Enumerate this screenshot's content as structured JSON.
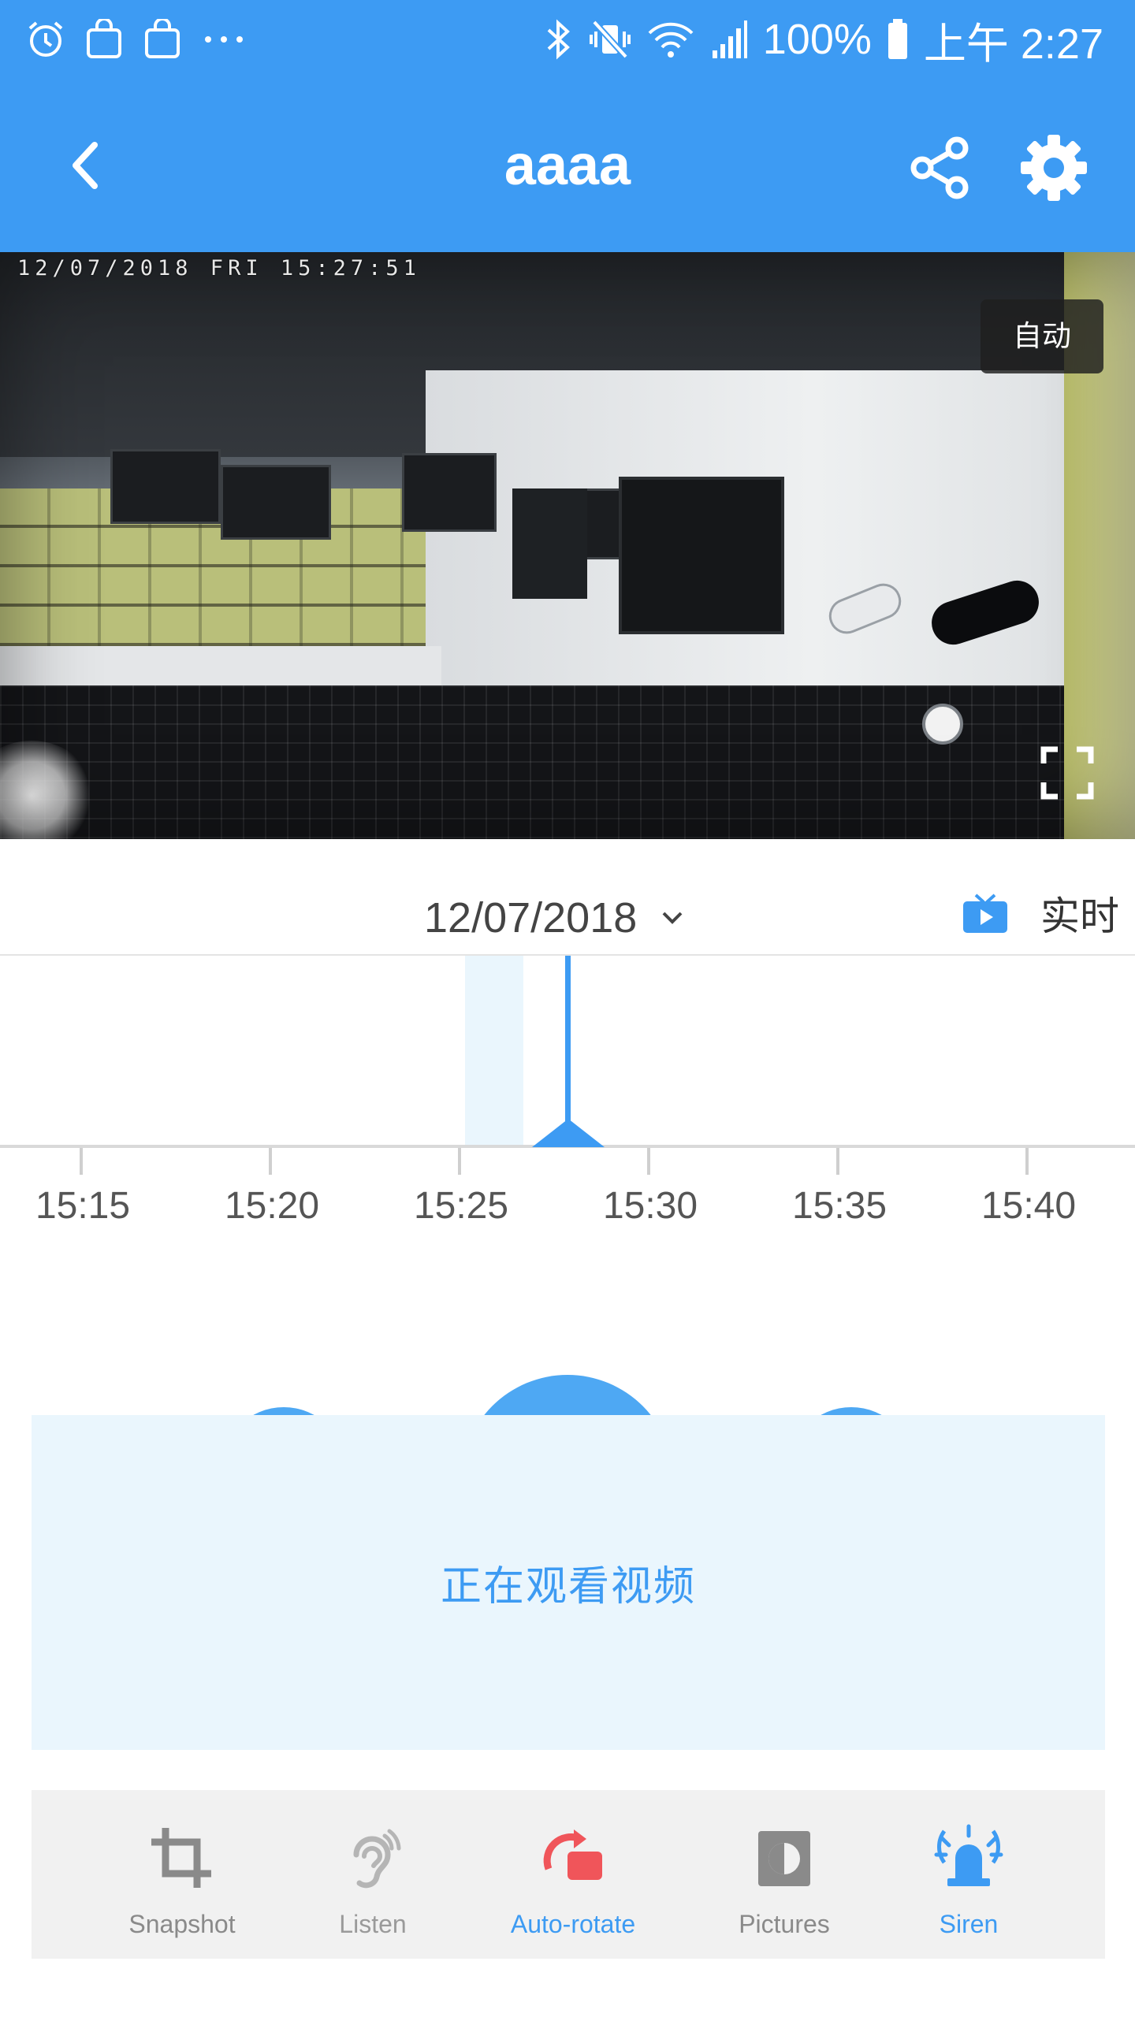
{
  "status_bar": {
    "battery": "100%",
    "time": "上午 2:27",
    "icons": [
      "alarm-icon",
      "shopping-bag-icon",
      "shopping-bag-icon",
      "more-dots-icon",
      "bluetooth-icon",
      "vibrate-mute-icon",
      "wifi-icon",
      "signal-icon",
      "battery-icon"
    ]
  },
  "app_bar": {
    "title": "aaaa",
    "icons": [
      "back-icon",
      "share-icon",
      "gear-icon"
    ]
  },
  "camera": {
    "osd_timestamp": "12/07/2018 FRI 15:27:51",
    "mode_badge": "自动",
    "icons": [
      "fullscreen-icon"
    ]
  },
  "date_row": {
    "date": "12/07/2018",
    "live_label": "实时",
    "icons": [
      "chevron-down-icon",
      "live-tv-icon"
    ]
  },
  "timeline": {
    "ticks": [
      "15:15",
      "15:20",
      "15:25",
      "15:30",
      "15:35",
      "15:40"
    ],
    "colors": {
      "accent": "#3d9bf3",
      "record": "#eaf6fd"
    }
  },
  "watch_panel": {
    "text": "正在观看视频"
  },
  "actions": [
    {
      "label": "Snapshot",
      "icon": "crop-icon",
      "color": "#8a8a8a"
    },
    {
      "label": "Listen",
      "icon": "ear-icon",
      "color": "#b5b5b5"
    },
    {
      "label": "Auto-rotate",
      "icon": "rotate-icon",
      "color": "#3d9bf3"
    },
    {
      "label": "Pictures",
      "icon": "pictures-icon",
      "color": "#8a8a8a"
    },
    {
      "label": "Siren",
      "icon": "siren-icon",
      "color": "#3d9bf3"
    }
  ],
  "colors": {
    "primary": "#3d9bf3",
    "autorotate_icon": "#f0555a",
    "panel_bg": "#eaf6fd"
  }
}
